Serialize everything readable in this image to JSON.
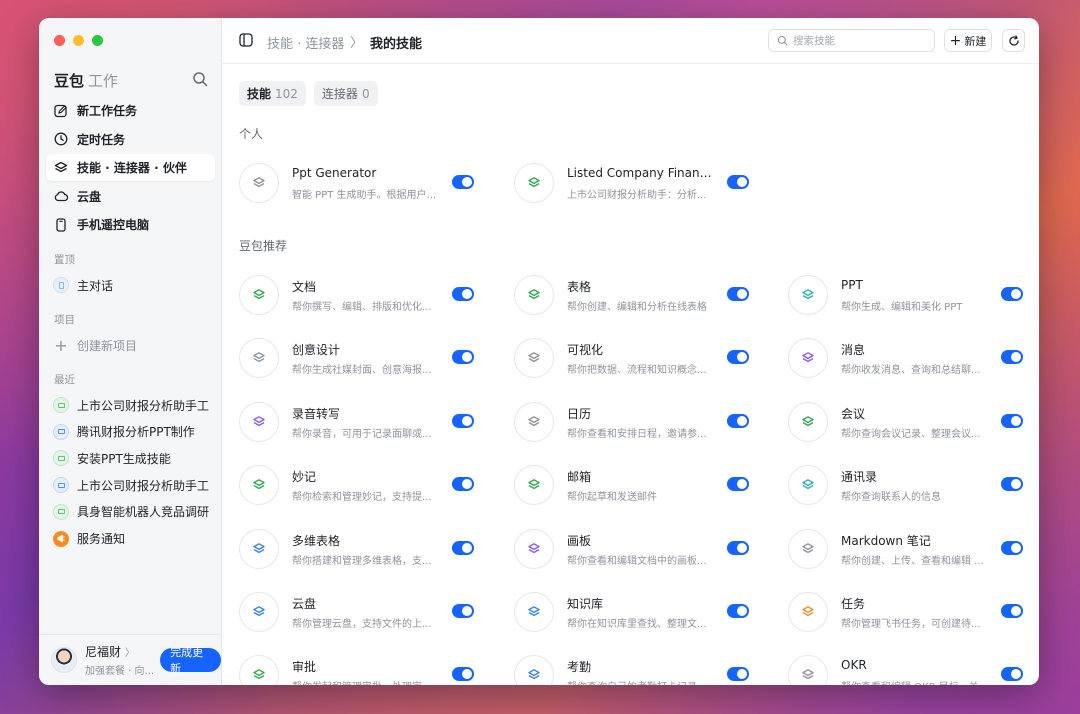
{
  "sidebar": {
    "brand": "豆包",
    "brand_sub": "工作",
    "nav": [
      {
        "label": "新工作任务",
        "icon": "edit-icon"
      },
      {
        "label": "定时任务",
        "icon": "clock-icon"
      },
      {
        "label": "技能 · 连接器 · 伙伴",
        "icon": "layers-icon"
      },
      {
        "label": "云盘",
        "icon": "cloud-icon"
      },
      {
        "label": "手机遥控电脑",
        "icon": "phone-icon"
      }
    ],
    "pinned_label": "置顶",
    "pinned": [
      {
        "label": "主对话"
      }
    ],
    "projects_label": "项目",
    "create_project": "创建新项目",
    "recent_label": "最近",
    "recent": [
      {
        "label": "上市公司财报分析助手工",
        "color": "green"
      },
      {
        "label": "腾讯财报分析PPT制作",
        "color": "blue"
      },
      {
        "label": "安装PPT生成技能",
        "color": "green"
      },
      {
        "label": "上市公司财报分析助手工",
        "color": "blue"
      },
      {
        "label": "具身智能机器人竞品调研",
        "color": "green"
      },
      {
        "label": "服务通知",
        "color": "orange"
      }
    ],
    "user": {
      "name": "尼福财",
      "chevron": "〉",
      "plan": "加强套餐 · 向...",
      "update_label": "完成更新"
    }
  },
  "topbar": {
    "breadcrumb_parent": "技能 · 连接器",
    "breadcrumb_sep": "〉",
    "breadcrumb_current": "我的技能",
    "search_placeholder": "搜索技能",
    "new_label": "新建"
  },
  "tabs": [
    {
      "label": "技能",
      "count": "102",
      "active": true
    },
    {
      "label": "连接器",
      "count": "0",
      "active": false
    }
  ],
  "groups": {
    "personal": "个人",
    "recommended": "豆包推荐"
  },
  "personal_skills": [
    {
      "name": "Ppt Generator",
      "desc": "智能 PPT 生成助手。根据用户...",
      "color": "#8f959e"
    },
    {
      "name": "Listed Company Financi...",
      "desc": "上市公司财报分析助手：分析...",
      "color": "#34a853"
    }
  ],
  "recommended_skills": [
    {
      "name": "文档",
      "desc": "帮你撰写、编辑、排版和优化...",
      "color": "#34a853"
    },
    {
      "name": "表格",
      "desc": "帮你创建、编辑和分析在线表格",
      "color": "#34a853"
    },
    {
      "name": "PPT",
      "desc": "帮你生成、编辑和美化 PPT",
      "color": "#2fb5a8"
    },
    {
      "name": "创意设计",
      "desc": "帮你生成社媒封面、创意海报...",
      "color": "#8f959e"
    },
    {
      "name": "可视化",
      "desc": "帮你把数据、流程和知识概念...",
      "color": "#8f959e"
    },
    {
      "name": "消息",
      "desc": "帮你收发消息、查询和总结聊...",
      "color": "#8b5cf6"
    },
    {
      "name": "录音转写",
      "desc": "帮你录音，可用于记录面聊或...",
      "color": "#8b5cf6"
    },
    {
      "name": "日历",
      "desc": "帮你查看和安排日程，邀请参...",
      "color": "#8f959e"
    },
    {
      "name": "会议",
      "desc": "帮你查询会议记录、整理会议...",
      "color": "#34a853"
    },
    {
      "name": "妙记",
      "desc": "帮你检索和管理妙记，支持提...",
      "color": "#34a853"
    },
    {
      "name": "邮箱",
      "desc": "帮你起草和发送邮件",
      "color": "#34a853"
    },
    {
      "name": "通讯录",
      "desc": "帮你查询联系人的信息",
      "color": "#2fb5a8"
    },
    {
      "name": "多维表格",
      "desc": "帮你搭建和管理多维表格，支...",
      "color": "#3b82f6"
    },
    {
      "name": "画板",
      "desc": "帮你查看和编辑文档中的画板...",
      "color": "#8b5cf6"
    },
    {
      "name": "Markdown 笔记",
      "desc": "帮你创建、上传、查看和编辑 ...",
      "color": "#8f959e"
    },
    {
      "name": "云盘",
      "desc": "帮你管理云盘，支持文件的上...",
      "color": "#3b82f6"
    },
    {
      "name": "知识库",
      "desc": "帮你在知识库里查找、整理文...",
      "color": "#3b82f6"
    },
    {
      "name": "任务",
      "desc": "帮你管理飞书任务，可创建待...",
      "color": "#f08c2e"
    },
    {
      "name": "审批",
      "desc": "帮你发起和管理审批，处理审...",
      "color": "#34a853"
    },
    {
      "name": "考勤",
      "desc": "帮你查询自己的考勤打卡记录...",
      "color": "#3b82f6"
    },
    {
      "name": "OKR",
      "desc": "帮你查看和编辑 OKR 目标、关...",
      "color": "#8f959e"
    }
  ]
}
